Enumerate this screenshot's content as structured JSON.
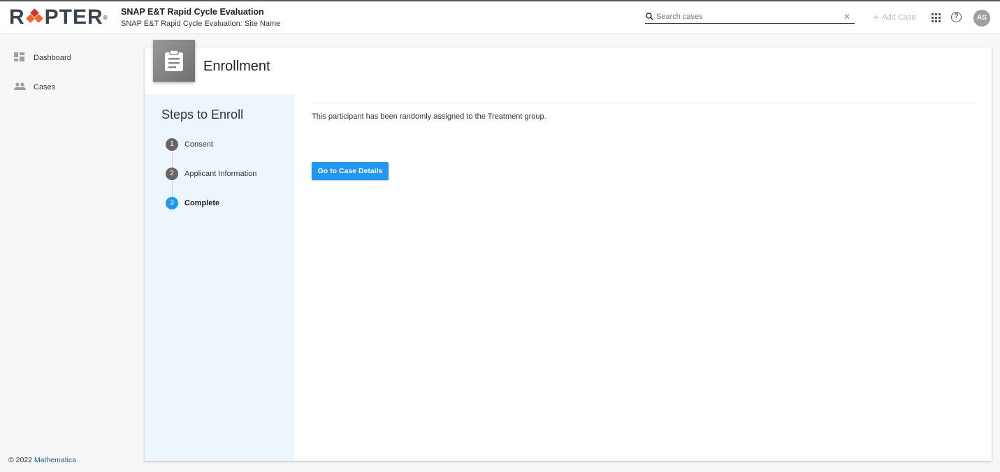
{
  "header": {
    "logo": "RAPTER",
    "title": "SNAP E&T Rapid Cycle Evaluation",
    "subtitle": "SNAP E&T Rapid Cycle Evaluation: Site Name",
    "search_placeholder": "Search cases",
    "add_case": "Add Case",
    "avatar": "AS"
  },
  "sidebar": {
    "items": [
      {
        "label": "Dashboard",
        "icon": "dashboard-icon"
      },
      {
        "label": "Cases",
        "icon": "people-icon"
      }
    ]
  },
  "footer": {
    "copyright": "© 2022",
    "link": "Mathematica"
  },
  "card": {
    "title": "Enrollment",
    "icon": "clipboard-icon"
  },
  "steps": {
    "title": "Steps to Enroll",
    "items": [
      {
        "num": "1",
        "label": "Consent",
        "state": "done"
      },
      {
        "num": "2",
        "label": "Applicant Information",
        "state": "done"
      },
      {
        "num": "3",
        "label": "Complete",
        "state": "active"
      }
    ]
  },
  "content": {
    "message": "This participant has been randomly assigned to the Treatment group.",
    "button": "Go to Case Details"
  },
  "colors": {
    "accent": "#2196f3",
    "logo_orange": "#f26522",
    "logo_red": "#d9342b"
  }
}
